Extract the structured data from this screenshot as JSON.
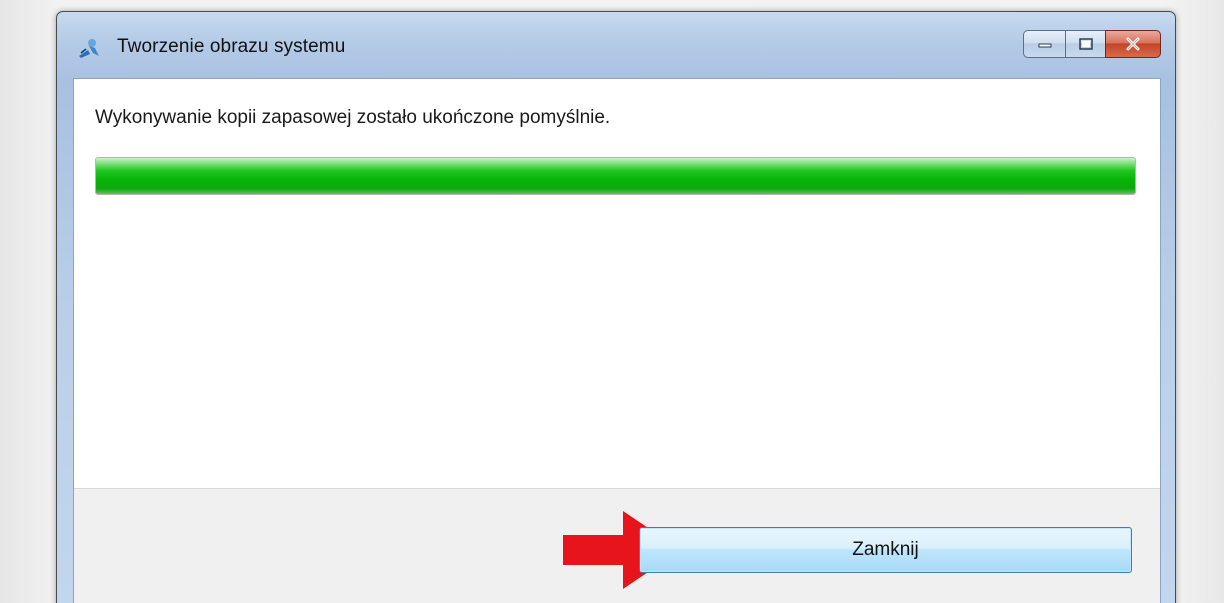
{
  "window": {
    "title": "Tworzenie obrazu systemu"
  },
  "caption_buttons": {
    "minimize": "minimize-icon",
    "maximize": "maximize-icon",
    "close": "close-icon"
  },
  "content": {
    "message": "Wykonywanie kopii zapasowej zostało ukończone pomyślnie.",
    "progress": 1.0
  },
  "footer": {
    "close_button_label": "Zamknij"
  },
  "annotation": {
    "arrow_icon": "red-arrow-right-icon",
    "arrow_color": "#e8141c"
  },
  "colors": {
    "progress_green": "#06b506",
    "title_bar": "#b4cbe6",
    "close_button_red": "#c44426"
  }
}
